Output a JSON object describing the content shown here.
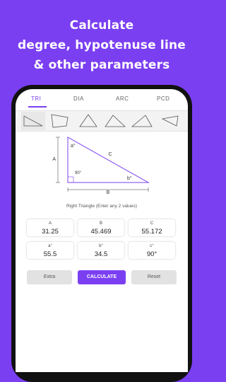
{
  "promo": {
    "line1": "Calculate",
    "line2": "degree, hypotenuse line",
    "line3": "& other parameters"
  },
  "tabs": [
    {
      "label": "TRI",
      "active": true
    },
    {
      "label": "DIA",
      "active": false
    },
    {
      "label": "ARC",
      "active": false
    },
    {
      "label": "PCD",
      "active": false
    }
  ],
  "diagram": {
    "side_a": "A",
    "side_b": "B",
    "side_c": "C",
    "angle_a": "a°",
    "angle_b": "b°",
    "right_angle": "90°",
    "caption": "Right Triangle (Enter any 2 values)"
  },
  "fields": [
    {
      "label": "A",
      "value": "31.25"
    },
    {
      "label": "B",
      "value": "45.469"
    },
    {
      "label": "C",
      "value": "55.172"
    },
    {
      "label": "a°",
      "value": "55.5"
    },
    {
      "label": "b°",
      "value": "34.5"
    },
    {
      "label": "c°",
      "value": "90°"
    }
  ],
  "buttons": {
    "extra": "Extra",
    "calculate": "CALCULATE",
    "reset": "Reset"
  },
  "colors": {
    "accent": "#7b3ff2",
    "background": "#7b3ff2"
  }
}
